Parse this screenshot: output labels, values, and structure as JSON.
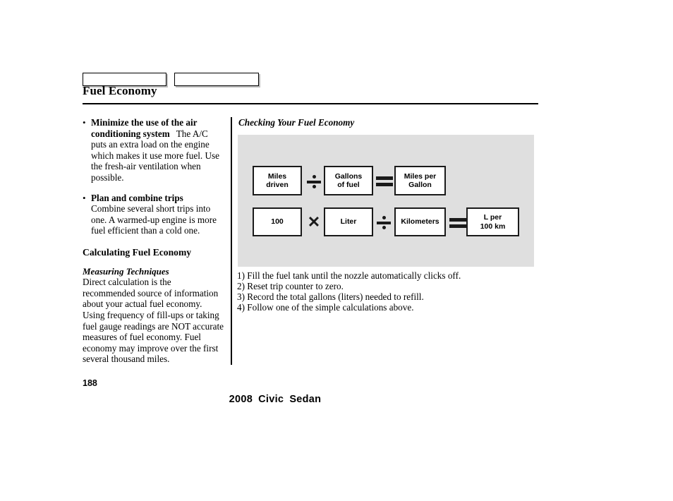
{
  "document": {
    "title": "Fuel Economy",
    "page_number": "188",
    "footer": {
      "year": "2008",
      "model": "Civic",
      "body_style": "Sedan"
    },
    "header_tabs": [
      {
        "label": ""
      },
      {
        "label": ""
      }
    ]
  },
  "left_column": {
    "bullets": [
      {
        "lead": "Minimize the use of the air conditioning system",
        "text": "The A/C puts an extra load on the engine which makes it use more fuel. Use the fresh-air ventilation when possible."
      },
      {
        "lead": "Plan and combine trips",
        "text": "Combine several short trips into one. A warmed-up engine is more fuel efficient than a cold one."
      }
    ],
    "section_heading": "Calculating Fuel Economy",
    "subsection_heading": "Measuring Techniques",
    "subsection_body": "Direct calculation is the recommended source of information about your actual fuel economy. Using frequency of fill-ups or taking fuel gauge readings are NOT accurate measures of fuel economy. Fuel economy may improve over the first several thousand miles."
  },
  "right_column": {
    "figure_caption": "Checking Your Fuel Economy",
    "diagram": {
      "background_color": "#dfdfdf",
      "rows": [
        {
          "terms": [
            {
              "kind": "box",
              "lines": [
                "Miles",
                "driven"
              ]
            },
            {
              "kind": "operator",
              "symbol": "divide"
            },
            {
              "kind": "box",
              "lines": [
                "Gallons",
                "of fuel"
              ]
            },
            {
              "kind": "operator",
              "symbol": "equals"
            },
            {
              "kind": "box",
              "lines": [
                "Miles per",
                "Gallon"
              ]
            }
          ]
        },
        {
          "terms": [
            {
              "kind": "box",
              "lines": [
                "100"
              ]
            },
            {
              "kind": "operator",
              "symbol": "multiply"
            },
            {
              "kind": "box",
              "lines": [
                "Liter"
              ]
            },
            {
              "kind": "operator",
              "symbol": "divide"
            },
            {
              "kind": "box",
              "lines": [
                "Kilometers"
              ]
            },
            {
              "kind": "operator",
              "symbol": "equals"
            },
            {
              "kind": "box",
              "lines": [
                "L per",
                "100 km"
              ]
            }
          ]
        }
      ]
    },
    "steps": [
      "1) Fill the fuel tank until the nozzle automatically clicks off.",
      "2) Reset trip counter to zero.",
      "3) Record the total gallons (liters) needed to refill.",
      "4) Follow one of the simple calculations above."
    ]
  }
}
